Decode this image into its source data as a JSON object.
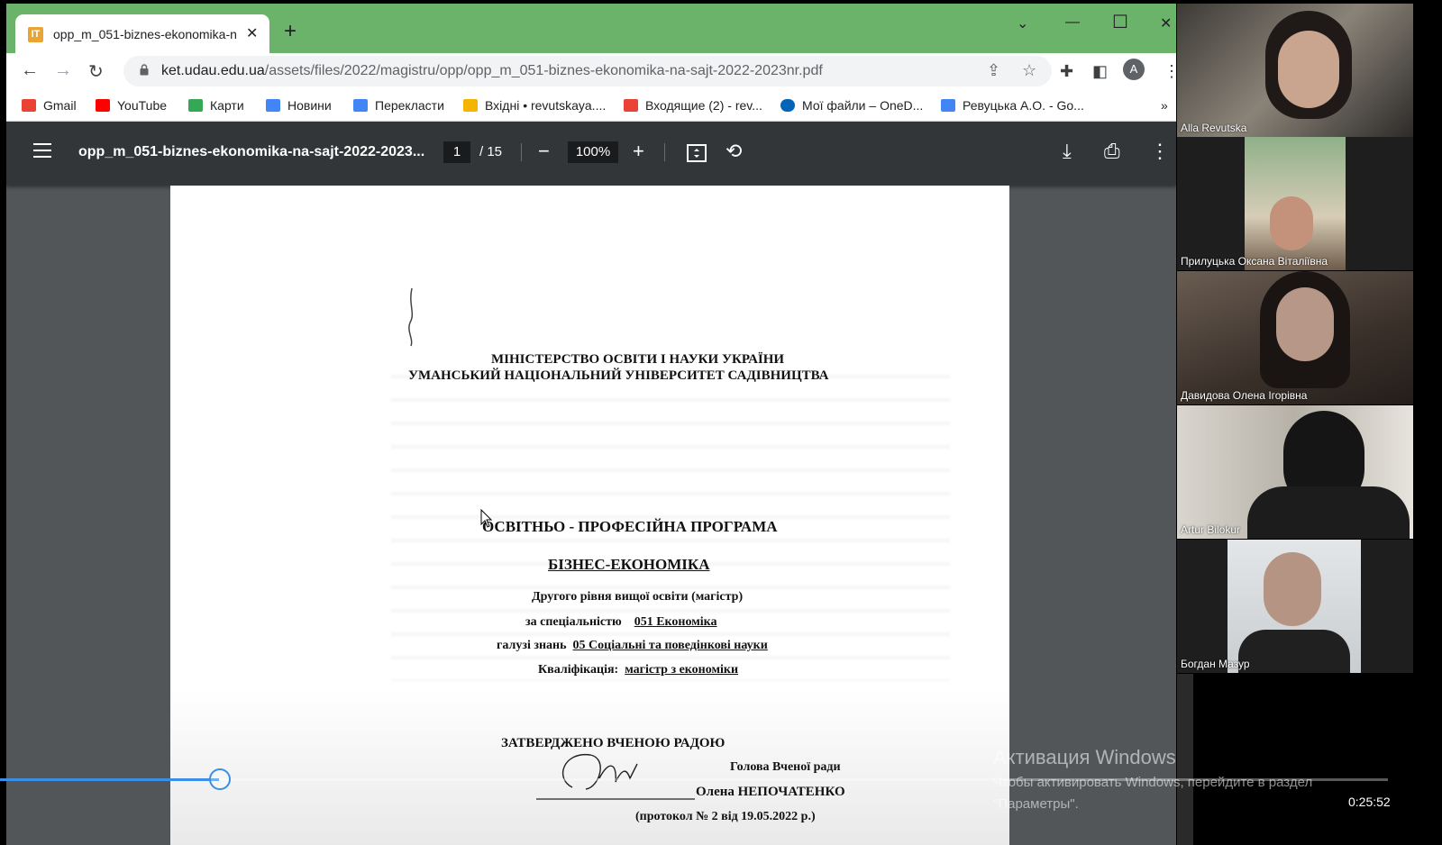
{
  "browser": {
    "tab_title": "opp_m_051-biznes-ekonomika-n",
    "tab_favicon": "ІТ",
    "new_tab": "+",
    "url_host": "ket.udau.edu.ua",
    "url_path": "/assets/files/2022/magistru/opp/opp_m_051-biznes-ekonomika-na-sajt-2022-2023nr.pdf",
    "profile_initial": "A",
    "titlebar_color": "#6bb36b",
    "bookmarks": [
      {
        "label": "Gmail",
        "color": "#ea4335"
      },
      {
        "label": "YouTube",
        "color": "#ff0000"
      },
      {
        "label": "Карти",
        "color": "#34a853"
      },
      {
        "label": "Новини",
        "color": "#4285f4"
      },
      {
        "label": "Перекласти",
        "color": "#4285f4"
      },
      {
        "label": "Вхідні • revutskaya....",
        "color": "#f4b400"
      },
      {
        "label": "Входящие (2) - rev...",
        "color": "#ea4335"
      },
      {
        "label": "Мої файли – OneD...",
        "color": "#0364b8"
      },
      {
        "label": "Ревуцька А.О. - Go...",
        "color": "#4285f4"
      }
    ],
    "bookmarks_more": "»"
  },
  "pdf_viewer": {
    "title": "opp_m_051-biznes-ekonomika-na-sajt-2022-2023...",
    "current_page": "1",
    "total_pages": "/ 15",
    "zoom": "100%"
  },
  "document": {
    "ministry": "МІНІСТЕРСТВО ОСВІТИ І НАУКИ УКРАЇНИ",
    "university": "УМАНСЬКИЙ НАЦІОНАЛЬНИЙ УНІВЕРСИТЕТ САДІВНИЦТВА",
    "program_heading": "ОСВІТНЬО - ПРОФЕСІЙНА ПРОГРАМА",
    "program_name": "БІЗНЕС-ЕКОНОМІКА",
    "level": "Другого рівня  вищої освіти (магістр)",
    "specialty_label": "за спеціальністю",
    "specialty_value": "051  Економіка",
    "field_label": "галузі знань",
    "field_value": "05   Соціальні та поведінкові науки",
    "qualification_label": "Кваліфікація:",
    "qualification_value": "магістр  з економіки",
    "approved": "ЗАТВЕРДЖЕНО ВЧЕНОЮ РАДОЮ",
    "chair_title": "Голова Вченої ради",
    "chair_name": "Олена  НЕПОЧАТЕНКО",
    "protocol": "(протокол № 2  від 19.05.2022 р.)"
  },
  "participants": [
    {
      "name": "Alla Revutska"
    },
    {
      "name": "Прилуцька Оксана Віталіївна"
    },
    {
      "name": "Давидова Олена Ігорівна"
    },
    {
      "name": "Artur Bilokur"
    },
    {
      "name": "Богдан Мазур"
    }
  ],
  "player": {
    "progress": 0.158,
    "time": "0:25:52"
  },
  "watermark": {
    "line1": "Активация Windows",
    "line2": "Чтобы активировать Windows, перейдите в раздел",
    "line3": "\"Параметры\"."
  }
}
